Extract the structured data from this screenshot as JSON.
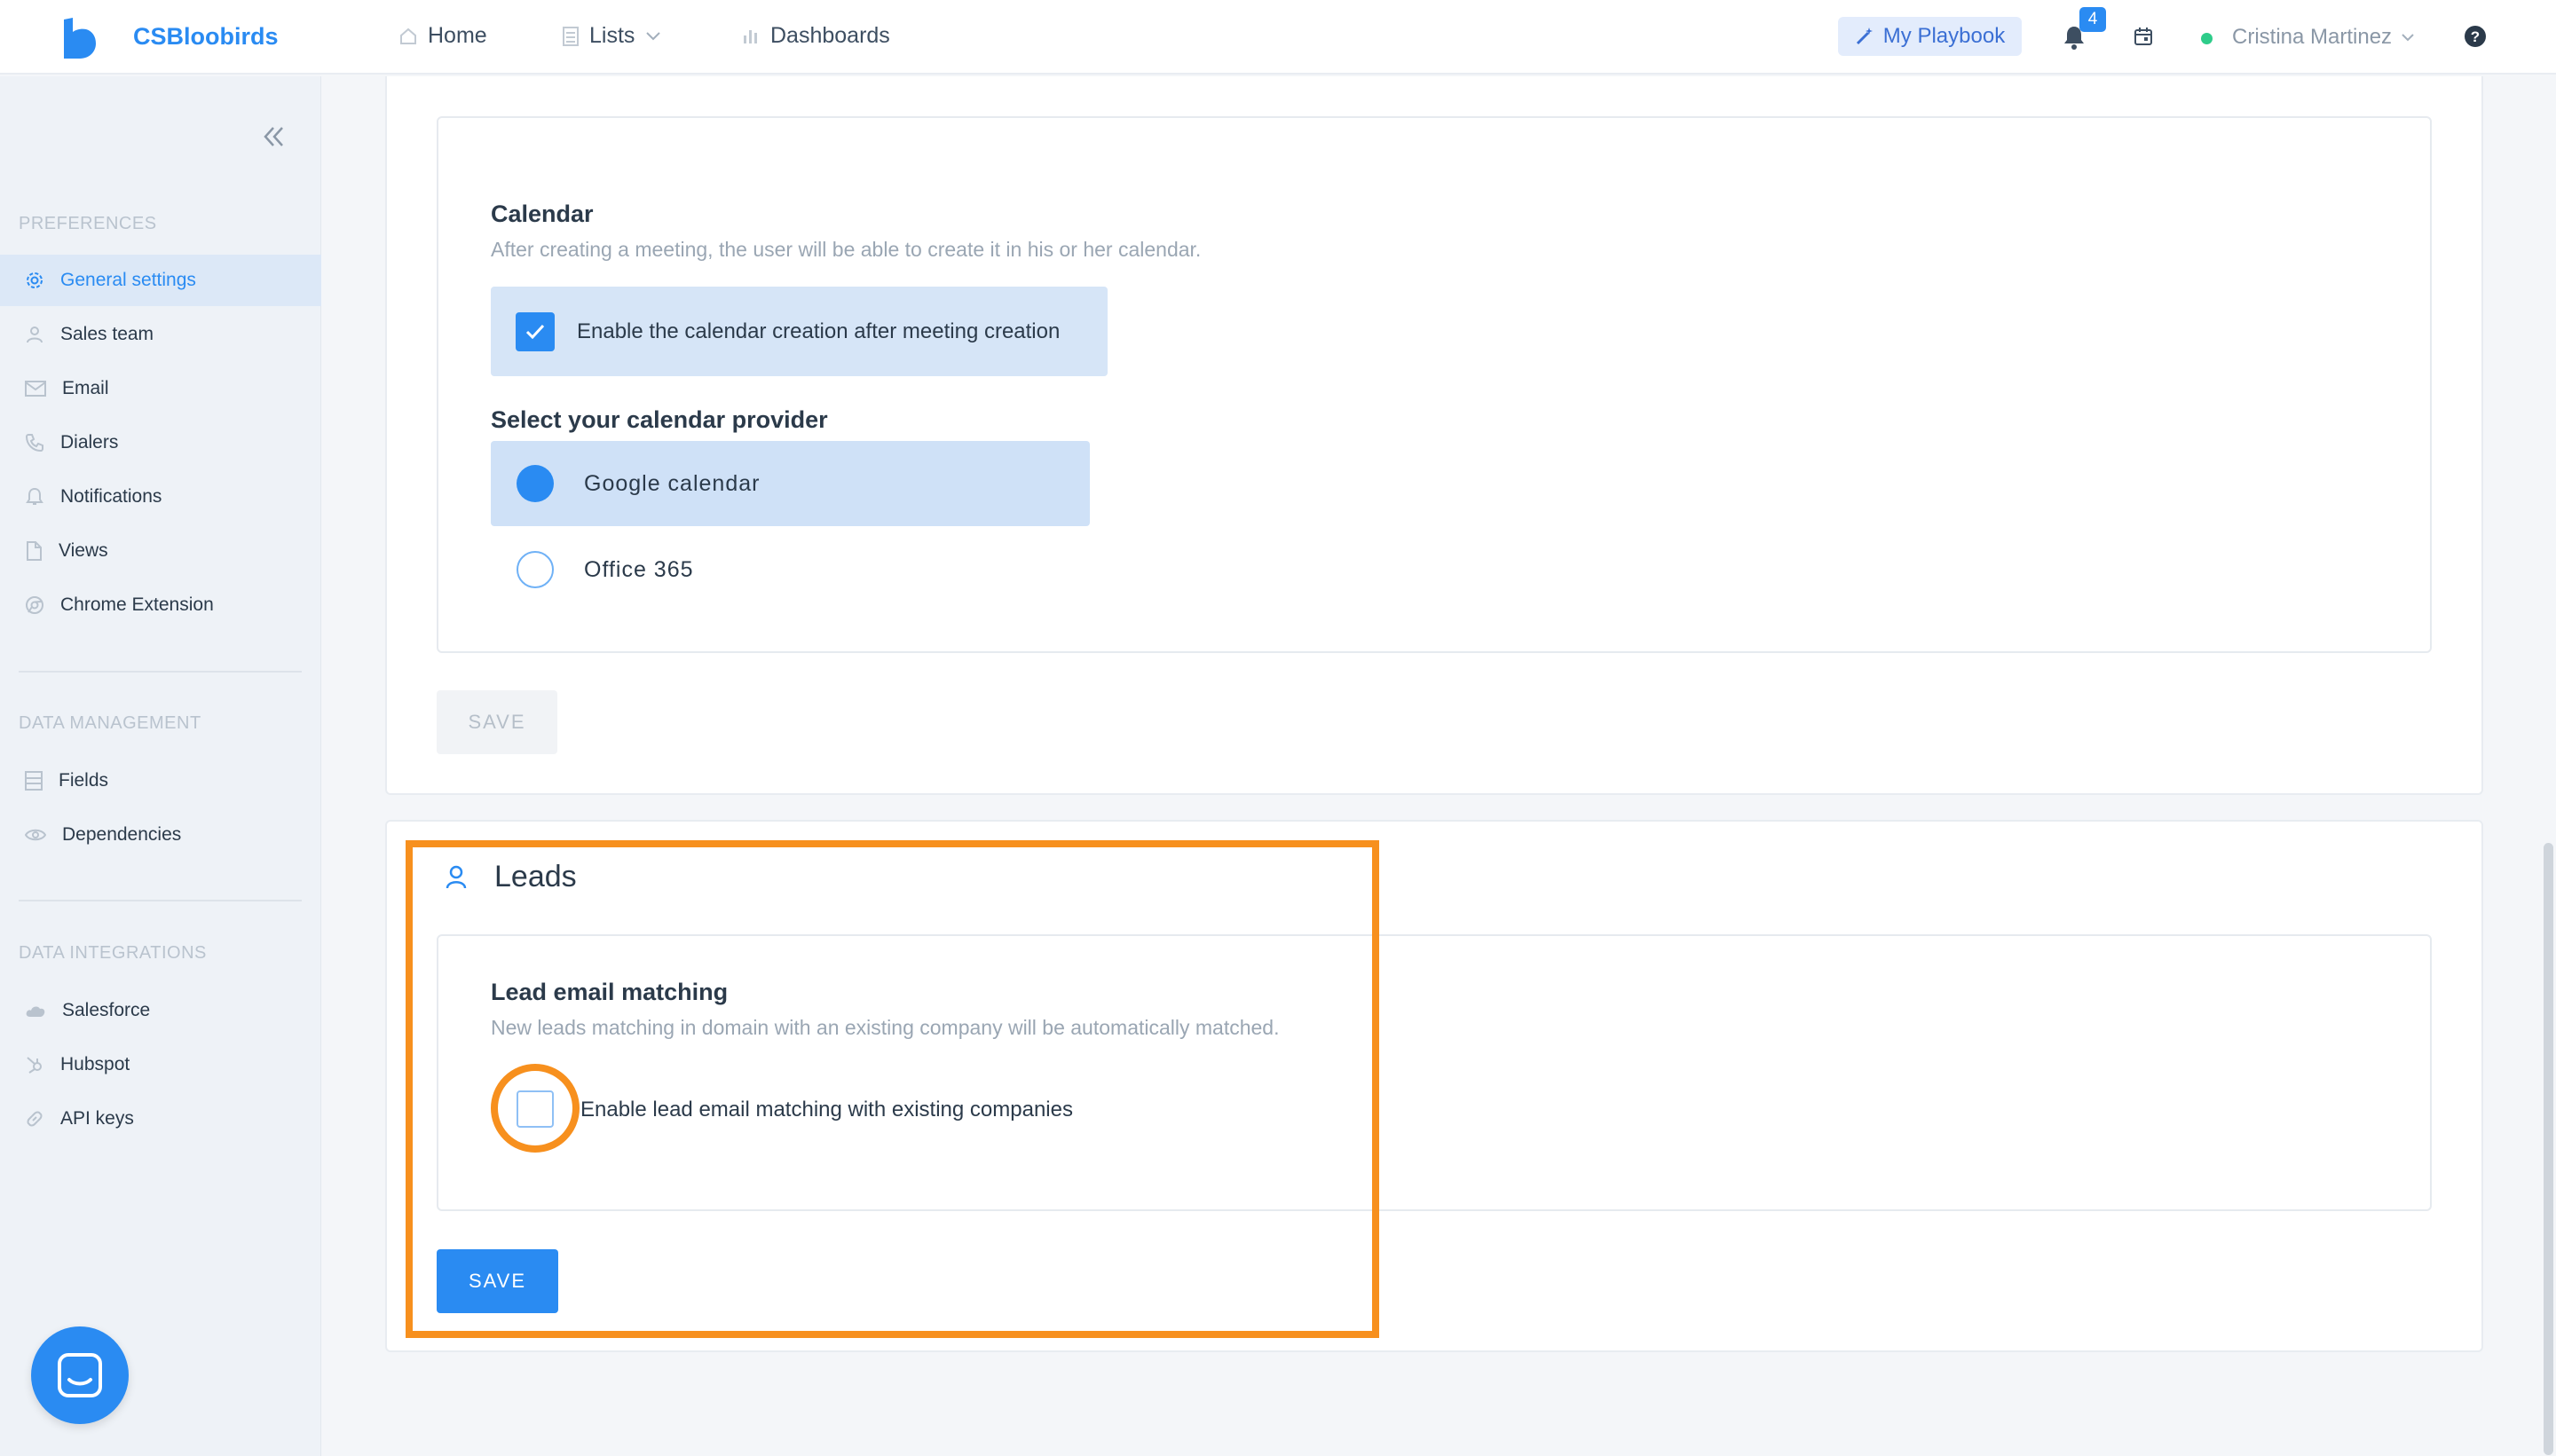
{
  "app": {
    "brand": "CSBloobirds",
    "accent_color": "#2a8bf2",
    "highlight_color": "#f7901e"
  },
  "topnav": {
    "home": "Home",
    "lists": "Lists",
    "dashboards": "Dashboards",
    "playbook": "My Playbook",
    "notification_count": "4",
    "user_name": "Cristina Martinez",
    "user_status": "online"
  },
  "sidebar": {
    "sections": [
      {
        "title": "PREFERENCES",
        "items": [
          {
            "label": "General settings",
            "icon": "gear-icon",
            "active": true
          },
          {
            "label": "Sales team",
            "icon": "user-icon"
          },
          {
            "label": "Email",
            "icon": "mail-icon"
          },
          {
            "label": "Dialers",
            "icon": "phone-icon"
          },
          {
            "label": "Notifications",
            "icon": "bell-icon"
          },
          {
            "label": "Views",
            "icon": "file-icon"
          },
          {
            "label": "Chrome Extension",
            "icon": "chrome-icon"
          }
        ]
      },
      {
        "title": "DATA MANAGEMENT",
        "items": [
          {
            "label": "Fields",
            "icon": "list-icon"
          },
          {
            "label": "Dependencies",
            "icon": "eye-icon"
          }
        ]
      },
      {
        "title": "DATA INTEGRATIONS",
        "items": [
          {
            "label": "Salesforce",
            "icon": "cloud-icon"
          },
          {
            "label": "Hubspot",
            "icon": "hubspot-icon"
          },
          {
            "label": "API keys",
            "icon": "link-icon"
          }
        ]
      }
    ]
  },
  "calendar": {
    "title": "Calendar",
    "description": "After creating a meeting, the user will be able to create it in his or her calendar.",
    "checkbox_label": "Enable the calendar creation after meeting creation",
    "checkbox_checked": true,
    "provider_title": "Select your calendar provider",
    "providers": [
      {
        "label": "Google calendar",
        "selected": true
      },
      {
        "label": "Office 365",
        "selected": false
      }
    ],
    "save_label": "SAVE",
    "save_enabled": false
  },
  "leads": {
    "title": "Leads",
    "section_title": "Lead email matching",
    "description": "New leads matching in domain with an existing company will be automatically matched.",
    "checkbox_label": "Enable lead email matching with existing companies",
    "checkbox_checked": false,
    "save_label": "SAVE",
    "save_enabled": true
  }
}
